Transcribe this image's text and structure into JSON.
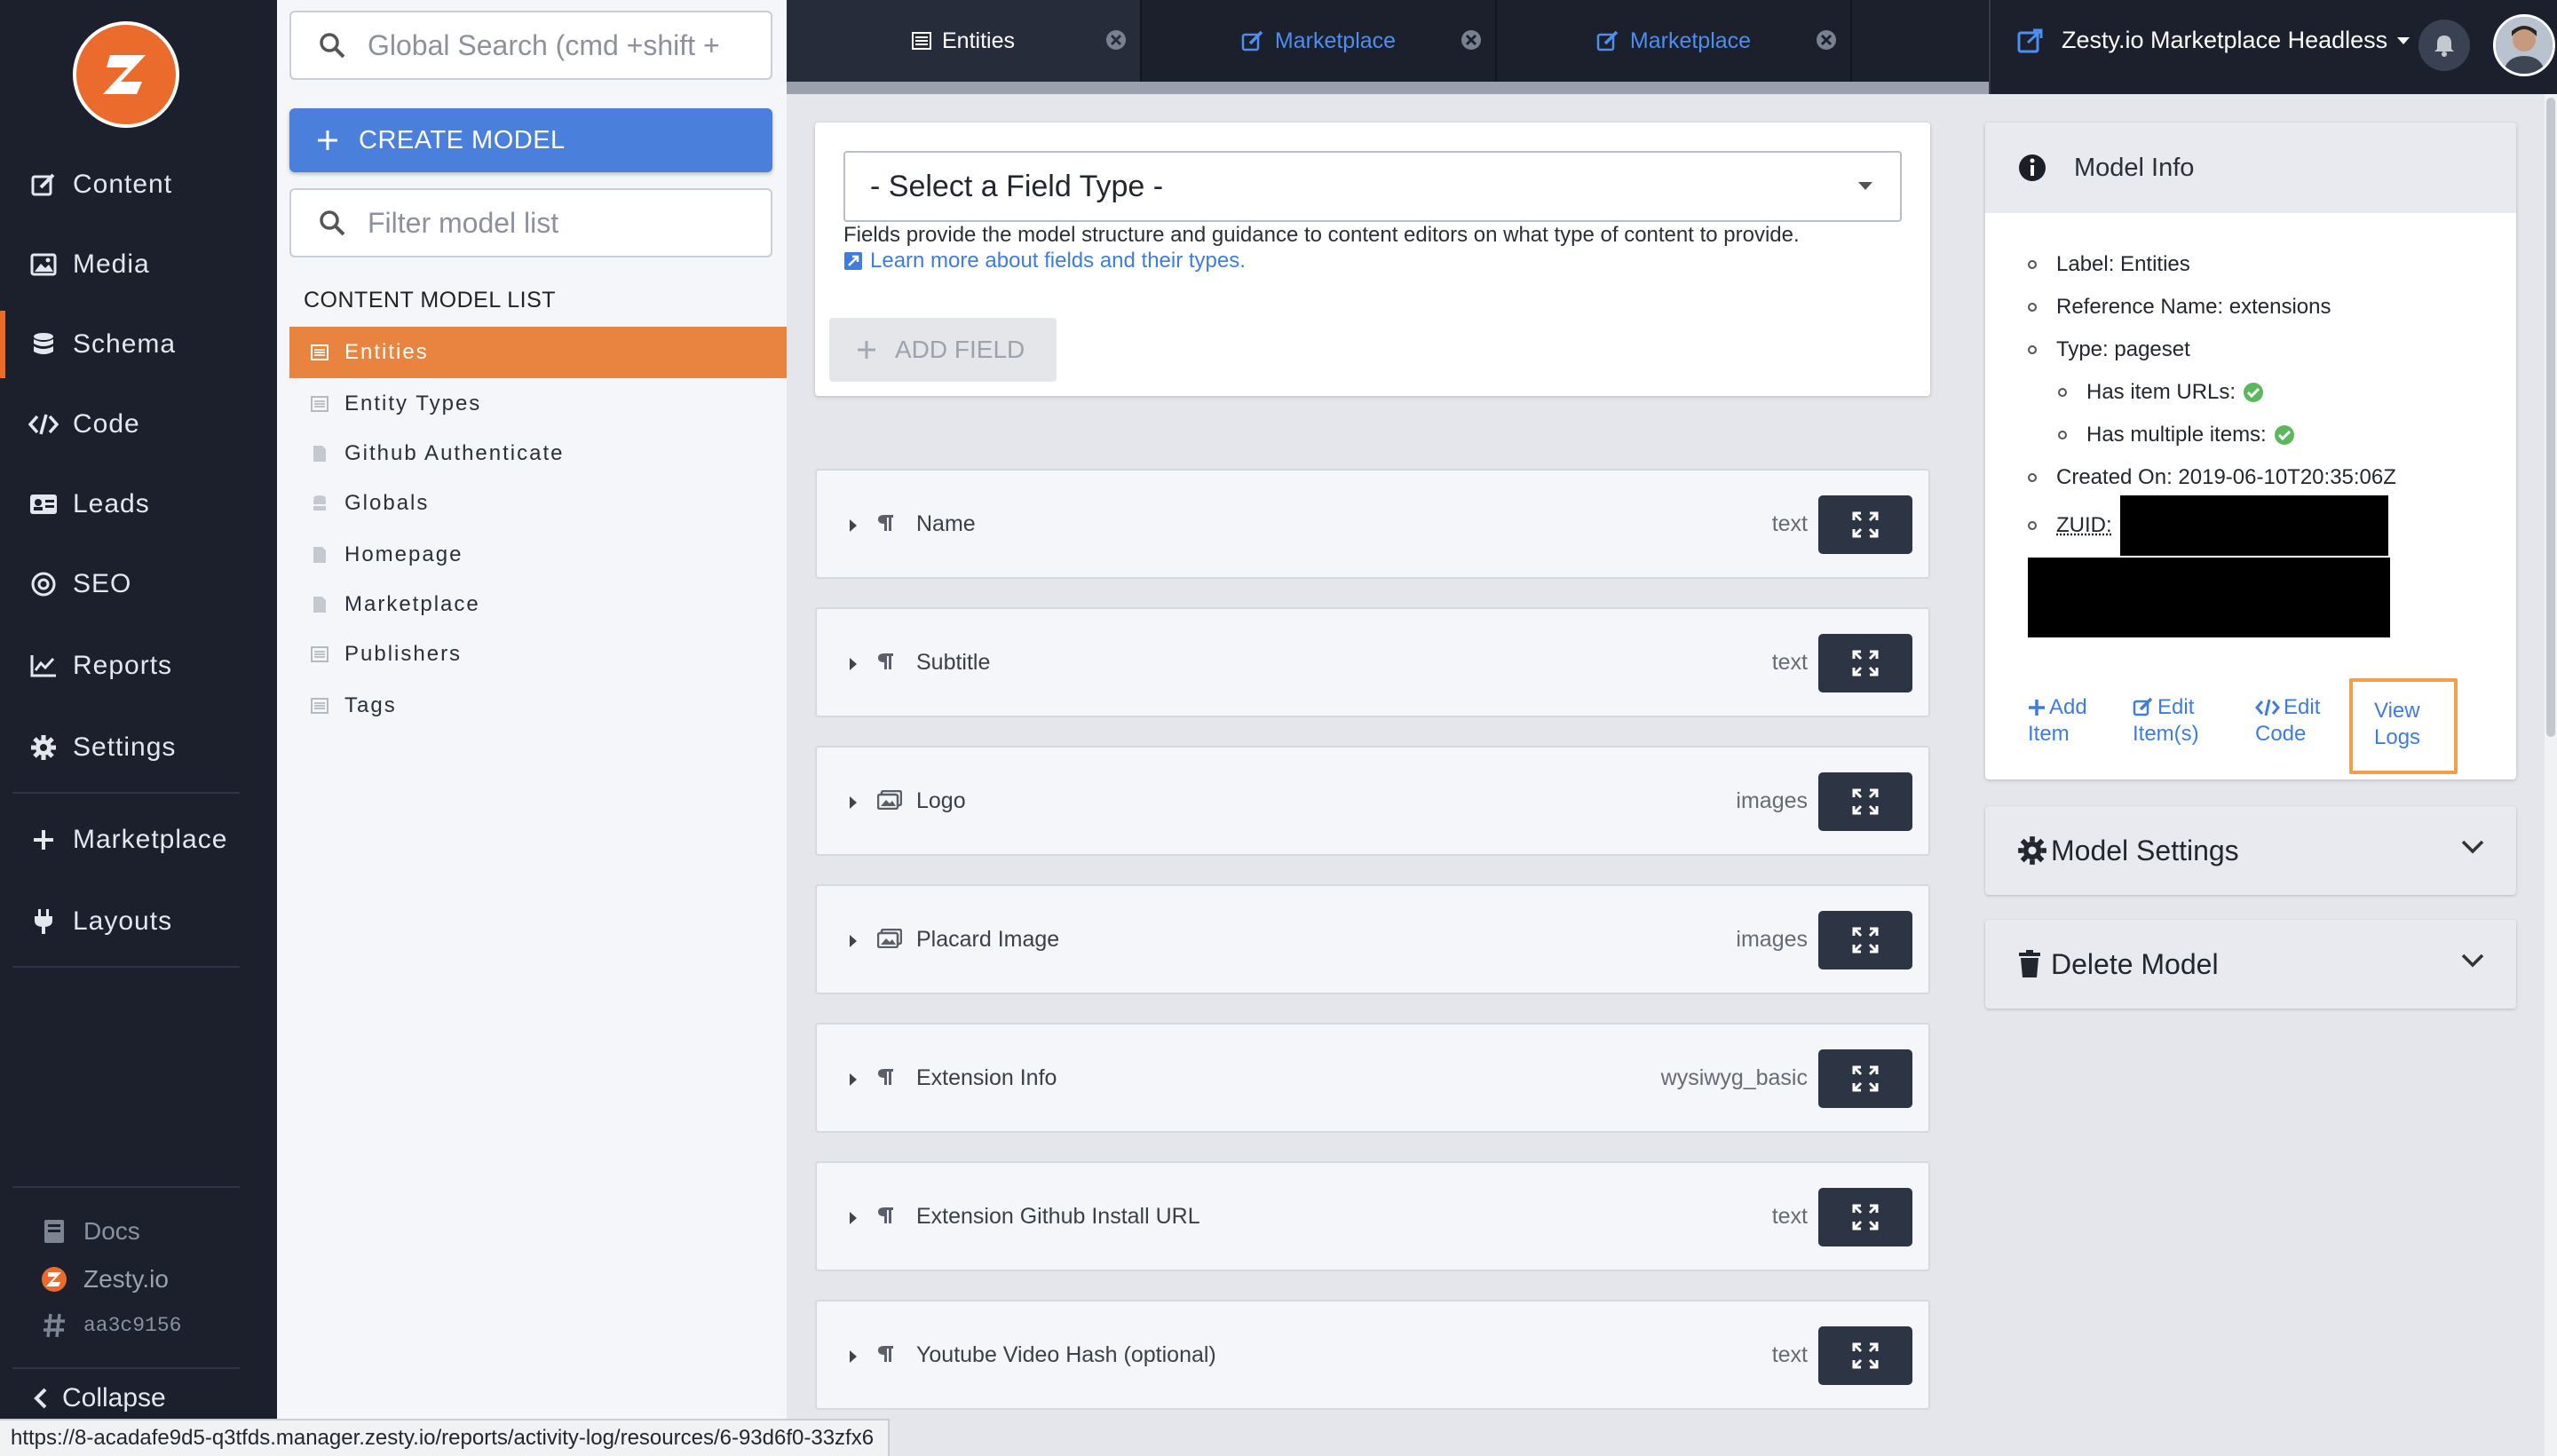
{
  "nav": {
    "items": [
      {
        "label": "Content",
        "icon": "edit-icon"
      },
      {
        "label": "Media",
        "icon": "image-icon"
      },
      {
        "label": "Schema",
        "icon": "database-icon"
      },
      {
        "label": "Code",
        "icon": "code-icon"
      },
      {
        "label": "Leads",
        "icon": "id-card-icon"
      },
      {
        "label": "SEO",
        "icon": "target-icon"
      },
      {
        "label": "Reports",
        "icon": "line-chart-icon"
      },
      {
        "label": "Settings",
        "icon": "gear-icon"
      }
    ],
    "extra_items": [
      {
        "label": "Marketplace",
        "icon": "plus-icon"
      },
      {
        "label": "Layouts",
        "icon": "plug-icon"
      }
    ],
    "footer": {
      "docs": "Docs",
      "zesty": "Zesty.io",
      "hash": "aa3c9156"
    },
    "collapse": "Collapse",
    "active": "Schema"
  },
  "search": {
    "placeholder": "Global Search (cmd +shift +"
  },
  "model_list": {
    "create_label": "CREATE MODEL",
    "filter_placeholder": "Filter model list",
    "heading": "CONTENT MODEL LIST",
    "items": [
      "Entities",
      "Entity Types",
      "Github Authenticate",
      "Globals",
      "Homepage",
      "Marketplace",
      "Publishers",
      "Tags"
    ],
    "active": "Entities"
  },
  "tabs": [
    {
      "label": "Entities",
      "active": true
    },
    {
      "label": "Marketplace",
      "active": false
    },
    {
      "label": "Marketplace",
      "active": false
    }
  ],
  "header": {
    "instance": "Zesty.io Marketplace Headless"
  },
  "add_field": {
    "select_label": "- Select a Field Type -",
    "description": "Fields provide the model structure and guidance to content editors on what type of content to provide.",
    "learn_link": "Learn more about fields and their types.",
    "button_label": "ADD FIELD"
  },
  "fields": [
    {
      "name": "Name",
      "type": "text",
      "icon": "paragraph-icon"
    },
    {
      "name": "Subtitle",
      "type": "text",
      "icon": "paragraph-icon"
    },
    {
      "name": "Logo",
      "type": "images",
      "icon": "image-icon"
    },
    {
      "name": "Placard Image",
      "type": "images",
      "icon": "image-icon"
    },
    {
      "name": "Extension Info",
      "type": "wysiwyg_basic",
      "icon": "paragraph-icon"
    },
    {
      "name": "Extension Github Install URL",
      "type": "text",
      "icon": "paragraph-icon"
    },
    {
      "name": "Youtube Video Hash (optional)",
      "type": "text",
      "icon": "paragraph-icon"
    }
  ],
  "model_info": {
    "title": "Model Info",
    "label": "Label: Entities",
    "reference": "Reference Name: extensions",
    "type": "Type: pageset",
    "has_urls": "Has item URLs:",
    "has_multiple": "Has multiple items:",
    "created": "Created On: 2019-06-10T20:35:06Z",
    "zuid": "ZUID:",
    "actions": {
      "add_item": [
        "Add",
        "Item"
      ],
      "edit_items": [
        "Edit",
        "Item(s)"
      ],
      "edit_code": [
        "Edit",
        "Code"
      ],
      "view_logs": [
        "View",
        "Logs"
      ]
    }
  },
  "model_settings": "Model Settings",
  "delete_model": "Delete Model",
  "status_url": "https://8-acadafe9d5-q3tfds.manager.zesty.io/reports/activity-log/resources/6-93d6f0-33zfx6",
  "colors": {
    "accent": "#e88340",
    "primary": "#4a80dc",
    "link": "#3d7ddf",
    "nav_bg": "#1b202c",
    "success": "#5cb85c"
  }
}
